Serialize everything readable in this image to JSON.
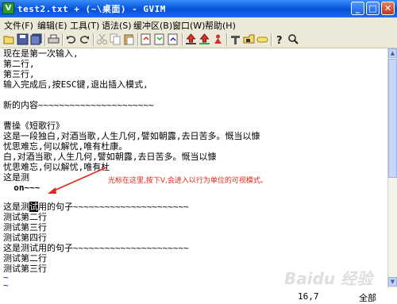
{
  "window": {
    "title": "test2.txt + (~\\桌面) - GVIM",
    "app_icon": "V",
    "minimize_icon": "_",
    "maximize_icon": "□",
    "close_icon": "✕"
  },
  "menubar": [
    "文件(F)",
    "编辑(E)",
    "工具(T)",
    "语法(S)",
    "缓冲区(B)",
    "窗口(W)",
    "帮助(H)"
  ],
  "toolbar": {
    "icons": [
      "open-icon",
      "save-icon",
      "save-all-icon",
      "print-icon",
      "undo-icon",
      "redo-icon",
      "cut-icon",
      "copy-icon",
      "paste-icon",
      "find-replace-icon",
      "find-next-icon",
      "find-prev-icon",
      "load-session-icon",
      "save-session-icon",
      "run-script-icon",
      "make-icon",
      "run-ctags-icon",
      "tag-jump-icon",
      "help-icon",
      "find-help-icon"
    ]
  },
  "editor": {
    "lines": [
      "现在是第一次输入,",
      "第二行,",
      "第三行,",
      "输入完成后,按ESC键,退出插入模式,",
      "",
      "新的内容~~~~~~~~~~~~~~~~~~~~~~",
      "",
      "曹操《短歌行》",
      "这是一段独白,对酒当歌,人生几何,譬如朝露,去日苦多。慨当以慷",
      "忧思难忘,何以解忧,唯有杜康。",
      "白,对酒当歌,人生几何,譬如朝露,去日苦多。慨当以慷",
      "忧思难忘,何以解忧,唯有杜",
      "这是测",
      "  on~~~",
      "",
      "这是测",
      "测试第二行",
      "测试第三行",
      "测试第四行",
      "这是测试用的句子~~~~~~~~~~~~~~~~~~~~~~",
      "测试第二行",
      "测试第三行",
      "~",
      "~"
    ],
    "cursor_line_prefix": "这是测",
    "cursor_char": "试",
    "cursor_line_suffix": "用的句子~~~~~~~~~~~~~~~~~~~~~~"
  },
  "annotation": {
    "text": "光标在这里,按下V,会进入以行为单位的可视模式。",
    "color": "#e0261a"
  },
  "statusline": {
    "position": "16,7",
    "scroll": "全部"
  },
  "watermark": "Baidu 经验"
}
